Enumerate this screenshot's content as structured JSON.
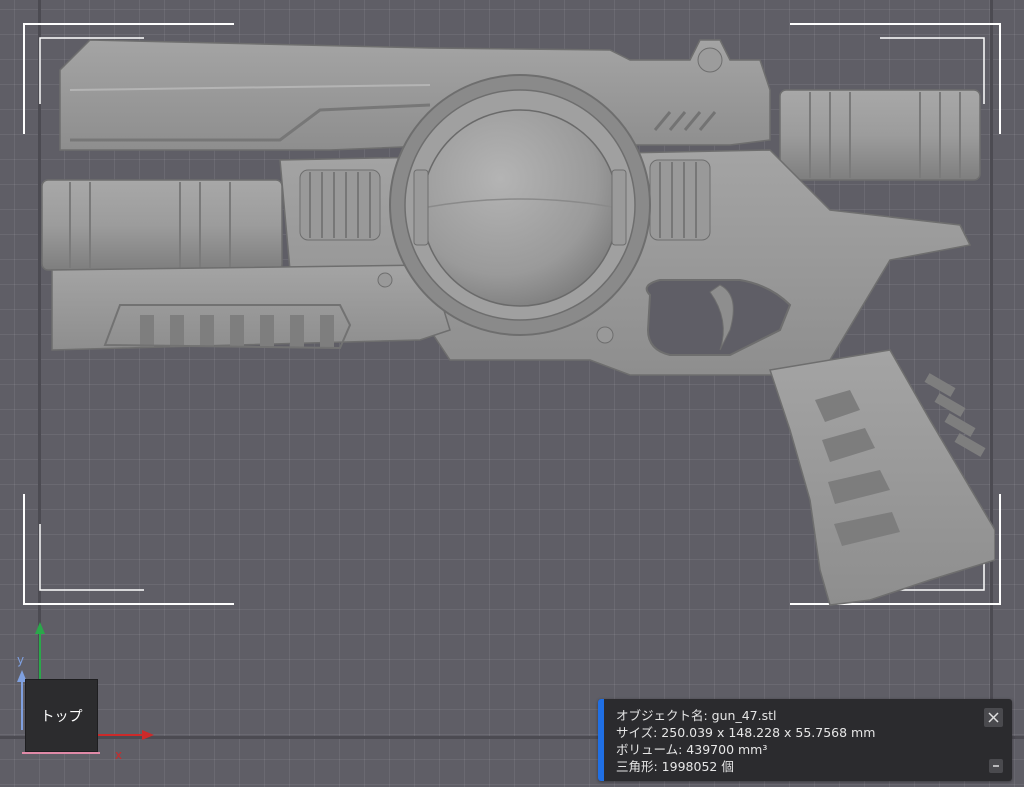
{
  "viewport": {
    "view_cube_label": "トップ",
    "axis_y_label": "y",
    "axis_x_label": "x",
    "axis_colors": {
      "x": "#cc2a2a",
      "y": "#2aa84a",
      "z": "#7fa0e0"
    }
  },
  "model": {
    "icon": "pistol-model",
    "surface_color": "#9d9d9d"
  },
  "info_panel": {
    "object_name": "オブジェクト名: gun_47.stl",
    "size": "サイズ: 250.039 x 148.228 x 55.7568 mm",
    "volume": "ボリューム: 439700 mm³",
    "triangles": "三角形: 1998052 個",
    "accent_color": "#1f6fe5",
    "close_icon": "close-icon",
    "collapse_icon": "minus-icon"
  }
}
